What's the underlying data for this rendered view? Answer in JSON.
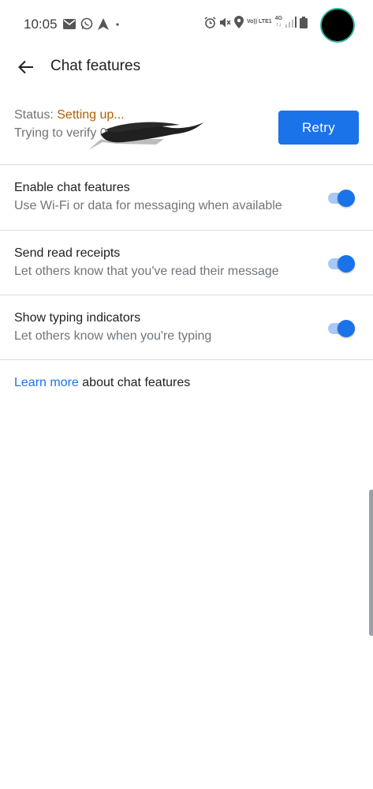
{
  "status_bar": {
    "time": "10:05",
    "left_icons": [
      "mail-icon",
      "whatsapp-icon",
      "navigation-icon",
      "dot-icon"
    ],
    "right_icons": [
      "alarm-icon",
      "mute-icon",
      "location-icon",
      "volte-icon",
      "4g-icon",
      "signal-icon",
      "battery-icon"
    ],
    "volte_label": "Vo)) LTE1",
    "net_label": "4G"
  },
  "app_bar": {
    "title": "Chat features",
    "back_icon": "back-arrow-icon"
  },
  "status": {
    "label": "Status: ",
    "value": "Setting up...",
    "verify_text": "Trying to verify 0",
    "retry_label": "Retry",
    "value_color": "#b06000"
  },
  "settings": [
    {
      "title": "Enable chat features",
      "subtitle": "Use Wi-Fi or data for messaging when available",
      "enabled": true
    },
    {
      "title": "Send read receipts",
      "subtitle": "Let others know that you've read their message",
      "enabled": true
    },
    {
      "title": "Show typing indicators",
      "subtitle": "Let others know when you're typing",
      "enabled": true
    }
  ],
  "learn_more": {
    "link_text": "Learn more",
    "rest_text": " about chat features"
  },
  "colors": {
    "accent": "#1a73e8",
    "toggle_track": "#a9c8f4",
    "divider": "#dadce0"
  }
}
